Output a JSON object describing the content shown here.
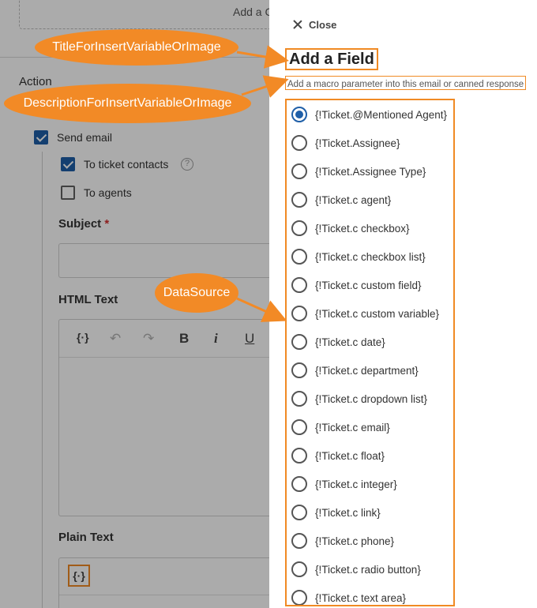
{
  "background": {
    "add_button_partial": "Add a C",
    "action_label": "Action",
    "send_email_label": "Send email",
    "to_ticket_contacts_label": "To ticket contacts",
    "help_glyph": "?",
    "to_agents_label": "To agents",
    "subject_label": "Subject",
    "required_mark": "*",
    "html_text_label": "HTML Text",
    "plain_text_label": "Plain Text",
    "toolbar": {
      "insert_variable_glyph": "{·}",
      "undo_glyph": "↶",
      "redo_glyph": "↷",
      "bold_glyph": "B",
      "italic_glyph": "i",
      "underline_glyph": "U"
    }
  },
  "panel": {
    "close_label": "Close",
    "title": "Add a Field",
    "description": "Add a macro parameter into this email or canned response",
    "selected_index": 0,
    "fields": [
      "{!Ticket.@Mentioned Agent}",
      "{!Ticket.Assignee}",
      "{!Ticket.Assignee Type}",
      "{!Ticket.c agent}",
      "{!Ticket.c checkbox}",
      "{!Ticket.c checkbox list}",
      "{!Ticket.c custom field}",
      "{!Ticket.c custom variable}",
      "{!Ticket.c date}",
      "{!Ticket.c department}",
      "{!Ticket.c dropdown list}",
      "{!Ticket.c email}",
      "{!Ticket.c float}",
      "{!Ticket.c integer}",
      "{!Ticket.c link}",
      "{!Ticket.c phone}",
      "{!Ticket.c radio button}",
      "{!Ticket.c text area}"
    ]
  },
  "annotations": {
    "title_callout": "TitleForInsertVariableOrImage",
    "description_callout": "DescriptionForInsertVariableOrImage",
    "datasource_callout": "DataSource"
  },
  "colors": {
    "annotation_orange": "#f28a26",
    "accent_blue": "#1f5fa8",
    "overlay": "rgba(0,0,0,0.33)"
  }
}
